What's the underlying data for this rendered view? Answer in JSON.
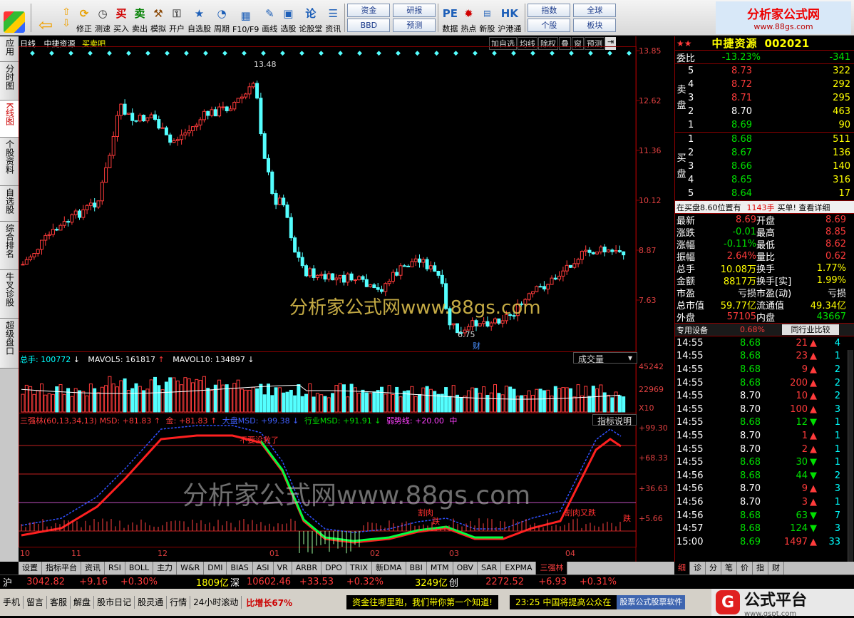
{
  "toolbar": {
    "buttons": [
      {
        "label": "修正",
        "icon": "refresh-icon",
        "color": "#e8a000"
      },
      {
        "label": "测速",
        "icon": "clock-icon",
        "color": "#333"
      },
      {
        "label": "买入",
        "icon": "buy-icon",
        "color": "#d00000"
      },
      {
        "label": "卖出",
        "icon": "sell-icon",
        "color": "#008000"
      },
      {
        "label": "模拟",
        "icon": "hammer-icon",
        "color": "#884400"
      },
      {
        "label": "开户",
        "icon": "lock-icon",
        "color": "#555"
      },
      {
        "label": "自选股",
        "icon": "star-icon",
        "color": "#1d5fb8"
      },
      {
        "label": "周期",
        "icon": "period-icon",
        "color": "#1d5fb8"
      },
      {
        "label": "F10/F9",
        "icon": "f10-icon",
        "color": "#1d5fb8"
      },
      {
        "label": "画线",
        "icon": "pen-icon",
        "color": "#1d5fb8"
      },
      {
        "label": "选股",
        "icon": "select-icon",
        "color": "#1d5fb8"
      },
      {
        "label": "论股堂",
        "icon": "talk-icon",
        "color": "#1d5fb8"
      },
      {
        "label": "资讯",
        "icon": "news-icon",
        "color": "#1d5fb8"
      }
    ],
    "small_buttons": [
      [
        "资金",
        "BBD"
      ],
      [
        "研报",
        "预测"
      ]
    ],
    "buttons2": [
      {
        "label": "数据",
        "icon": "pe-icon",
        "color": "#1d5fb8"
      },
      {
        "label": "热点",
        "icon": "fire-icon",
        "color": "#d00000"
      },
      {
        "label": "新股",
        "icon": "newstock-icon",
        "color": "#1d5fb8"
      },
      {
        "label": "沪港通",
        "icon": "hk-icon",
        "color": "#1d5fb8"
      }
    ],
    "small_buttons2": [
      [
        "指数",
        "个股"
      ],
      [
        "全球",
        "板块"
      ]
    ],
    "logo_title": "分析家公式网",
    "logo_url": "www.88gs.com"
  },
  "sidetabs": [
    "应用",
    "分时图",
    "K线图",
    "个股资料",
    "自选股",
    "综合排名",
    "牛叉诊股",
    "超级盘口"
  ],
  "main_header": {
    "period": "日线",
    "stock": "中捷资源",
    "tag": "买卖吧",
    "buttons": [
      "加自选",
      "均线",
      "除权",
      "叠",
      "窗",
      "预测"
    ]
  },
  "price_axis": [
    "13.85",
    "12.62",
    "11.36",
    "10.12",
    "8.87",
    "7.63"
  ],
  "price_labels": {
    "high": "13.48",
    "low": "6.75",
    "finance_tag": "财"
  },
  "volume_header": {
    "total": "总手: 100772",
    "mavol5": "MAVOL5: 161817",
    "mavol10": "MAVOL10: 134897",
    "dropdown": "成交量"
  },
  "volume_axis": [
    "45242",
    "22969",
    "X10"
  ],
  "indicator_header": {
    "name": "三强林(60,13,34,13)",
    "msd": "MSD: +81.83",
    "gold": "金: +81.83",
    "market": "大盘MSD: +99.38",
    "industry": "行业MSD: +91.91",
    "weak": "弱势线: +20.00",
    "mid": "中",
    "explain": "指标说明"
  },
  "indicator_axis": [
    "+99.30",
    "+68.33",
    "+36.63",
    "+5.66"
  ],
  "indicator_labels": [
    "不要没救了",
    "割肉",
    "跌",
    "割肉又跌",
    "跌"
  ],
  "x_axis": [
    "10",
    "11",
    "12",
    "01",
    "02",
    "03",
    "04"
  ],
  "bottom_tabs": [
    "设置",
    "指标平台",
    "资讯",
    "RSI",
    "BOLL",
    "主力",
    "W&R",
    "DMI",
    "BIAS",
    "ASI",
    "VR",
    "ARBR",
    "DPO",
    "TRIX",
    "新DMA",
    "BBI",
    "MTM",
    "OBV",
    "SAR",
    "EXPMA",
    "三强林"
  ],
  "rp_tabs": [
    "细",
    "诊",
    "分",
    "笔",
    "价",
    "指",
    "财"
  ],
  "quote": {
    "name": "中捷资源",
    "code": "002021",
    "weibi_label": "委比",
    "weibi": "-13.23%",
    "weicha": "-341",
    "sell_label": "卖盘",
    "buy_label": "买盘",
    "sell": [
      {
        "level": "5",
        "price": "8.73",
        "vol": "322"
      },
      {
        "level": "4",
        "price": "8.72",
        "vol": "292"
      },
      {
        "level": "3",
        "price": "8.71",
        "vol": "295"
      },
      {
        "level": "2",
        "price": "8.70",
        "vol": "463"
      },
      {
        "level": "1",
        "price": "8.69",
        "vol": "90"
      }
    ],
    "buy": [
      {
        "level": "1",
        "price": "8.68",
        "vol": "511"
      },
      {
        "level": "2",
        "price": "8.67",
        "vol": "136"
      },
      {
        "level": "3",
        "price": "8.66",
        "vol": "140"
      },
      {
        "level": "4",
        "price": "8.65",
        "vol": "316"
      },
      {
        "level": "5",
        "price": "8.64",
        "vol": "17"
      }
    ],
    "notice_left": "在买盘8.60位置有",
    "notice_mid": "1143手",
    "notice_right": "买单! 查看详细",
    "stats": [
      [
        "最新",
        "8.69",
        "开盘",
        "8.69"
      ],
      [
        "涨跌",
        "-0.01",
        "最高",
        "8.85"
      ],
      [
        "涨幅",
        "-0.11%",
        "最低",
        "8.62"
      ],
      [
        "振幅",
        "2.64%",
        "量比",
        "0.62"
      ],
      [
        "总手",
        "10.08万",
        "换手",
        "1.77%"
      ],
      [
        "金额",
        "8817万",
        "换手[实]",
        "1.99%"
      ],
      [
        "市盈",
        "亏损",
        "市盈(动)",
        "亏损"
      ],
      [
        "总市值",
        "59.77亿",
        "流通值",
        "49.34亿"
      ],
      [
        "外盘",
        "57105",
        "内盘",
        "43667"
      ]
    ],
    "device_label": "专用设备",
    "device_pct": "0.68%",
    "industry_compare": "同行业比较",
    "ticks": [
      [
        "14:55",
        "8.68",
        "21",
        "4",
        "up"
      ],
      [
        "14:55",
        "8.68",
        "23",
        "1",
        "up"
      ],
      [
        "14:55",
        "8.68",
        "9",
        "2",
        "up"
      ],
      [
        "14:55",
        "8.68",
        "200",
        "2",
        "up"
      ],
      [
        "14:55",
        "8.70",
        "10",
        "2",
        "up"
      ],
      [
        "14:55",
        "8.70",
        "100",
        "3",
        "up"
      ],
      [
        "14:55",
        "8.68",
        "12",
        "1",
        "down"
      ],
      [
        "14:55",
        "8.70",
        "1",
        "1",
        "up"
      ],
      [
        "14:55",
        "8.70",
        "2",
        "1",
        "up"
      ],
      [
        "14:55",
        "8.68",
        "30",
        "1",
        "down"
      ],
      [
        "14:56",
        "8.68",
        "44",
        "2",
        "down"
      ],
      [
        "14:56",
        "8.70",
        "9",
        "3",
        "up"
      ],
      [
        "14:56",
        "8.70",
        "3",
        "1",
        "up"
      ],
      [
        "14:56",
        "8.68",
        "63",
        "7",
        "down"
      ],
      [
        "14:57",
        "8.68",
        "124",
        "3",
        "down"
      ],
      [
        "15:00",
        "8.69",
        "1497",
        "33",
        "up"
      ]
    ]
  },
  "status": {
    "sh_label": "沪",
    "sh_index": "3042.82",
    "sh_change": "+9.16",
    "sh_pct": "+0.30%",
    "sh_amount": "1809亿",
    "sz_label": "深",
    "sz_index": "10602.46",
    "sz_change": "+33.53",
    "sz_pct": "+0.32%",
    "sz_amount": "3249亿",
    "cy_label": "创",
    "cy_index": "2272.52",
    "cy_change": "+6.93",
    "cy_pct": "+0.31%"
  },
  "status2": {
    "items": [
      "手机",
      "留言",
      "客服",
      "解盘",
      "股市日记",
      "股灵通",
      "行情",
      "24小时滚动"
    ],
    "ticker1": "比增长67%",
    "ticker2": "资金往哪里跑，我们带你第一个知道!",
    "ticker3": "23:25 中国将提高公众在",
    "ticker4": "股票公式股票软件",
    "brand": "公式平台",
    "brand_url": "www.gspt.com"
  },
  "watermarks": [
    "分析家公式网www.88gs.com",
    "分析家公式网www.88gs.com"
  ],
  "colors": {
    "up": "#ff3b3b",
    "down": "#54ffff",
    "ma": "#ffffff",
    "msd": "#ff2020",
    "gold": "#00ff40",
    "market": "#3050ff"
  }
}
